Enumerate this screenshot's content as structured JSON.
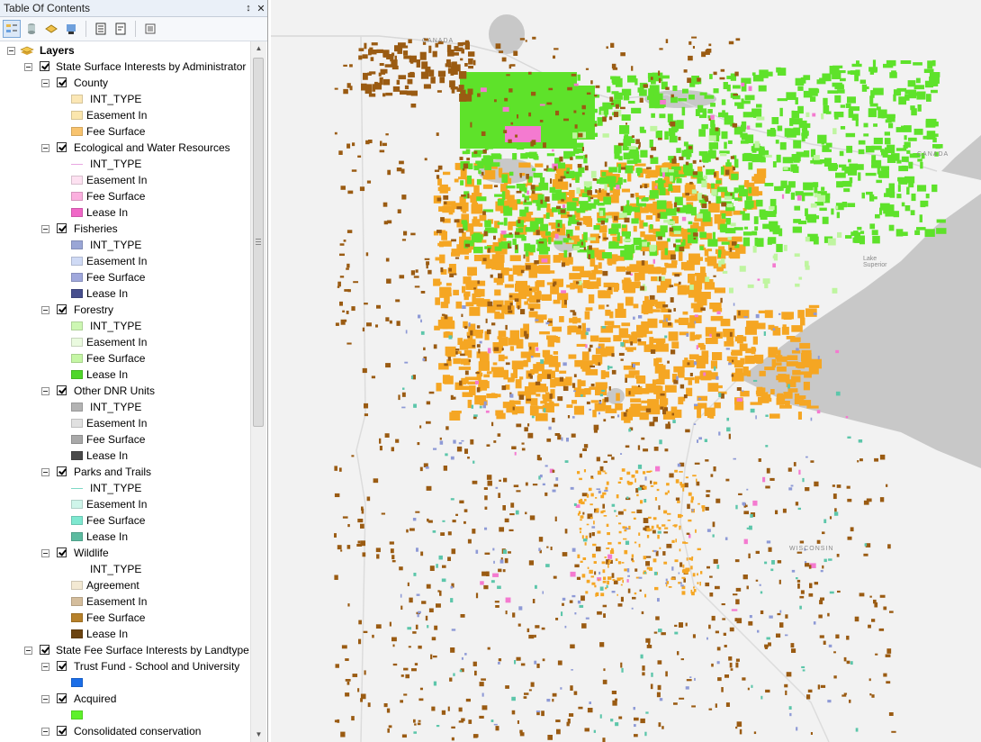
{
  "window": {
    "title": "Table Of Contents",
    "pin_glyph": "↕",
    "close_glyph": "✕"
  },
  "toolbar": {
    "buttons": [
      {
        "name": "list-by-drawing-order-icon",
        "active": true
      },
      {
        "name": "list-by-source-icon",
        "active": false
      },
      {
        "name": "list-by-visibility-icon",
        "active": false
      },
      {
        "name": "list-by-selection-icon",
        "active": false
      },
      {
        "name": "toc-options-icon",
        "active": false
      },
      {
        "name": "toc-properties-icon",
        "active": false
      },
      {
        "name": "toc-list-icon",
        "active": false
      }
    ]
  },
  "tree": {
    "root": "Layers",
    "groups": [
      {
        "label": "State Surface Interests by Administrator",
        "layers": [
          {
            "label": "County",
            "legend": [
              {
                "label": "INT_TYPE",
                "color": "#fbe7b5",
                "kind": "fill"
              },
              {
                "label": "Easement In",
                "color": "#fbe6ad",
                "kind": "fill"
              },
              {
                "label": "Fee Surface",
                "color": "#f8c36e",
                "kind": "fill"
              }
            ]
          },
          {
            "label": "Ecological and Water Resources",
            "legend": [
              {
                "label": "INT_TYPE",
                "color": "#e9a6e2",
                "kind": "line"
              },
              {
                "label": "Easement In",
                "color": "#fde1f1",
                "kind": "fill"
              },
              {
                "label": "Fee Surface",
                "color": "#fbb0df",
                "kind": "fill"
              },
              {
                "label": "Lease In",
                "color": "#f067c7",
                "kind": "fill"
              }
            ]
          },
          {
            "label": "Fisheries",
            "legend": [
              {
                "label": "INT_TYPE",
                "color": "#9aa6d6",
                "kind": "fill"
              },
              {
                "label": "Easement In",
                "color": "#cfdaf5",
                "kind": "fill"
              },
              {
                "label": "Fee Surface",
                "color": "#a0a8dc",
                "kind": "fill"
              },
              {
                "label": "Lease In",
                "color": "#474f8e",
                "kind": "fill"
              }
            ]
          },
          {
            "label": "Forestry",
            "legend": [
              {
                "label": "INT_TYPE",
                "color": "#cdf7b3",
                "kind": "fill"
              },
              {
                "label": "Easement In",
                "color": "#eafadf",
                "kind": "fill"
              },
              {
                "label": "Fee Surface",
                "color": "#c5f6a5",
                "kind": "fill"
              },
              {
                "label": "Lease In",
                "color": "#4fd62a",
                "kind": "fill"
              }
            ]
          },
          {
            "label": "Other DNR Units",
            "legend": [
              {
                "label": "INT_TYPE",
                "color": "#b3b3b3",
                "kind": "fill"
              },
              {
                "label": "Easement In",
                "color": "#e1e1e1",
                "kind": "fill"
              },
              {
                "label": "Fee Surface",
                "color": "#a9a9a9",
                "kind": "fill"
              },
              {
                "label": "Lease In",
                "color": "#4a4a4a",
                "kind": "fill"
              }
            ]
          },
          {
            "label": "Parks and Trails",
            "legend": [
              {
                "label": "INT_TYPE",
                "color": "#7ed8c5",
                "kind": "line"
              },
              {
                "label": "Easement In",
                "color": "#cff5ea",
                "kind": "fill"
              },
              {
                "label": "Fee Surface",
                "color": "#7ee8d0",
                "kind": "fill"
              },
              {
                "label": "Lease In",
                "color": "#5cbba0",
                "kind": "fill"
              }
            ]
          },
          {
            "label": "Wildlife",
            "legend": [
              {
                "label": "INT_TYPE",
                "color": "",
                "kind": "none"
              },
              {
                "label": "Agreement",
                "color": "#f3e9d3",
                "kind": "fill"
              },
              {
                "label": "Easement In",
                "color": "#d4bd9c",
                "kind": "fill"
              },
              {
                "label": "Fee Surface",
                "color": "#b7812a",
                "kind": "fill"
              },
              {
                "label": "Lease In",
                "color": "#6b4310",
                "kind": "fill"
              }
            ]
          }
        ]
      },
      {
        "label": "State Fee Surface Interests by Landtype",
        "layers": [
          {
            "label": "Trust Fund - School and University",
            "legend": [
              {
                "label": "",
                "color": "#1b6ee8",
                "kind": "fill"
              }
            ]
          },
          {
            "label": "Acquired",
            "legend": [
              {
                "label": "",
                "color": "#5ef12a",
                "kind": "fill"
              }
            ]
          },
          {
            "label": "Consolidated conservation",
            "legend": []
          }
        ]
      }
    ]
  },
  "map": {
    "labels": {
      "canada_west": "CANADA",
      "canada_east": "CANADA",
      "lake_superior": "Lake Superior",
      "wisconsin": "WISCONSIN"
    },
    "colors": {
      "background": "#f2f2f2",
      "water": "#c8c8c8",
      "orange": "#f5a623",
      "green": "#5ee22a",
      "brown": "#9a5b12",
      "pink": "#f47ad0",
      "lightgreen": "#bff5a0"
    }
  }
}
